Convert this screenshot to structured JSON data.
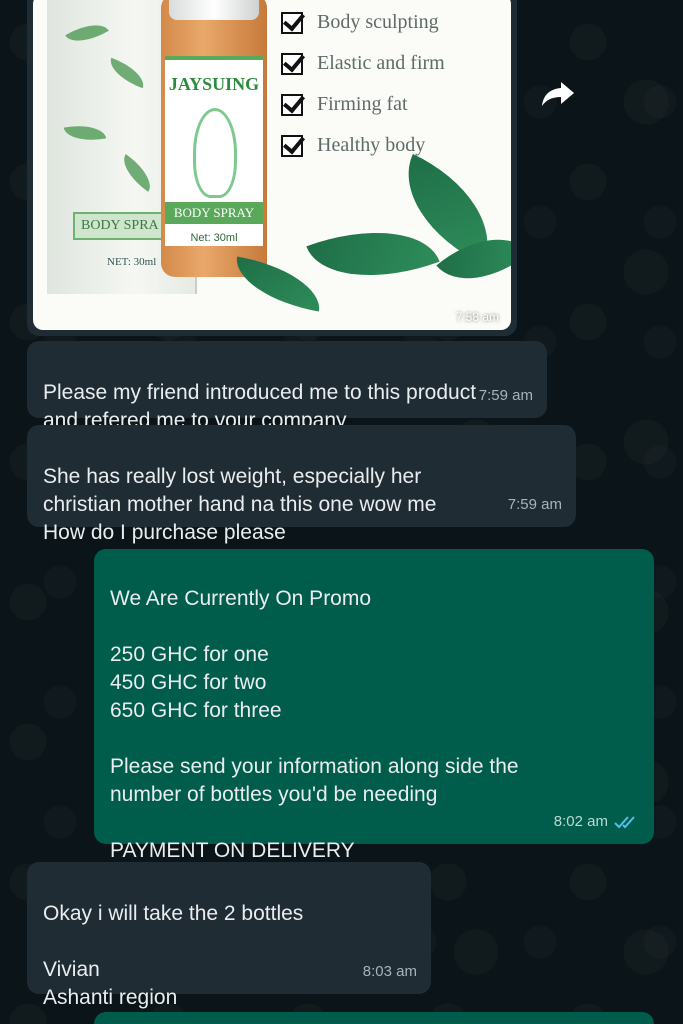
{
  "product_image": {
    "brand": "JAYSUING",
    "box_label": "BODY SPRA",
    "box_net": "NET: 30ml",
    "bottle_band": "BODY SPRAY",
    "bottle_net": "Net: 30ml",
    "features": [
      "Body sculpting",
      "Elastic and firm",
      "Firming fat",
      "Healthy body"
    ],
    "time": "7:58 am"
  },
  "messages": [
    {
      "direction": "incoming",
      "text": "Please my friend introduced me to this product\nand refered me to your company",
      "time": "7:59 am"
    },
    {
      "direction": "incoming",
      "text": "She has really lost weight, especially her\nchristian mother hand na this one wow me\nHow do I purchase please",
      "time": "7:59 am"
    },
    {
      "direction": "outgoing",
      "text": "We Are Currently On Promo\n\n250 GHC for one\n450 GHC for two\n650 GHC for three\n\nPlease send your information along side the\nnumber of bottles you'd be needing\n\nPAYMENT ON DELIVERY",
      "time": "8:02 am",
      "status": "read",
      "status_color": "#53bdeb"
    },
    {
      "direction": "incoming",
      "text": "Okay i will take the 2 bottles\n\nVivian\nAshanti region",
      "time": "8:03 am"
    }
  ],
  "colors": {
    "background": "#0b1418",
    "incoming_bubble": "#1f2c33",
    "outgoing_bubble": "#005c4b"
  }
}
